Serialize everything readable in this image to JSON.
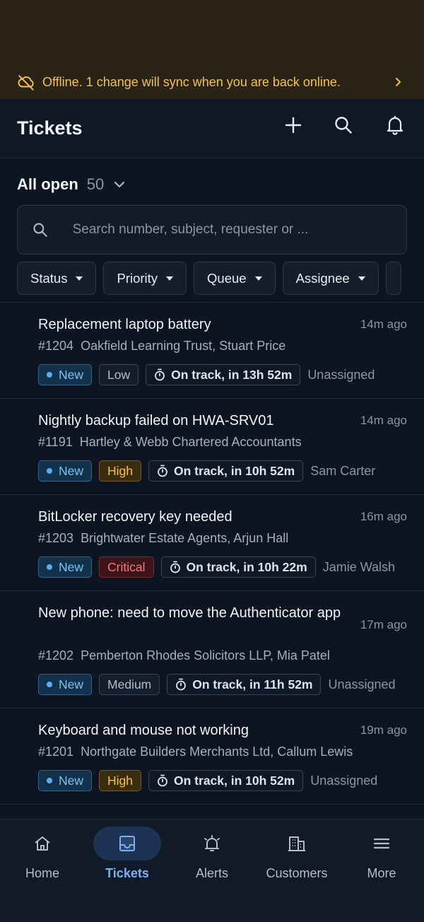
{
  "banner": {
    "text": "Offline. 1 change will sync when you are back online."
  },
  "header": {
    "title": "Tickets"
  },
  "filter": {
    "name": "All open",
    "count": "50"
  },
  "search": {
    "placeholder": "Search number, subject, requester or ..."
  },
  "chips": [
    "Status",
    "Priority",
    "Queue",
    "Assignee"
  ],
  "tickets": [
    {
      "subject": "Replacement laptop battery",
      "time": "14m ago",
      "number": "#1204",
      "requester": "Oakfield Learning Trust, Stuart Price",
      "status": "New",
      "priority": "Low",
      "sla": "On track, in 13h 52m",
      "assignee": "Unassigned"
    },
    {
      "subject": "Nightly backup failed on HWA-SRV01",
      "time": "14m ago",
      "number": "#1191",
      "requester": "Hartley & Webb Chartered Accountants",
      "status": "New",
      "priority": "High",
      "sla": "On track, in 10h 52m",
      "assignee": "Sam Carter"
    },
    {
      "subject": "BitLocker recovery key needed",
      "time": "16m ago",
      "number": "#1203",
      "requester": "Brightwater Estate Agents, Arjun Hall",
      "status": "New",
      "priority": "Critical",
      "sla": "On track, in 10h 22m",
      "assignee": "Jamie Walsh"
    },
    {
      "subject": "New phone: need to move the Authenticator app",
      "time": "17m ago",
      "number": "#1202",
      "requester": "Pemberton Rhodes Solicitors LLP, Mia Patel",
      "status": "New",
      "priority": "Medium",
      "sla": "On track, in 11h 52m",
      "assignee": "Unassigned"
    },
    {
      "subject": "Keyboard and mouse not working",
      "time": "19m ago",
      "number": "#1201",
      "requester": "Northgate Builders Merchants Ltd, Callum Lewis",
      "status": "New",
      "priority": "High",
      "sla": "On track, in 10h 52m",
      "assignee": "Unassigned"
    }
  ],
  "nav": [
    {
      "label": "Home",
      "icon": "home-icon"
    },
    {
      "label": "Tickets",
      "icon": "inbox-icon",
      "active": true
    },
    {
      "label": "Alerts",
      "icon": "alarm-icon"
    },
    {
      "label": "Customers",
      "icon": "building-icon"
    },
    {
      "label": "More",
      "icon": "menu-icon"
    }
  ],
  "colors": {
    "background": "#0d1522",
    "banner_bg": "#2a2417",
    "banner_text": "#f2c24b",
    "accent": "#7cb0f4",
    "status_new": "#5aaef0",
    "priority_high": "#f2c24b",
    "priority_critical": "#f27a80"
  }
}
